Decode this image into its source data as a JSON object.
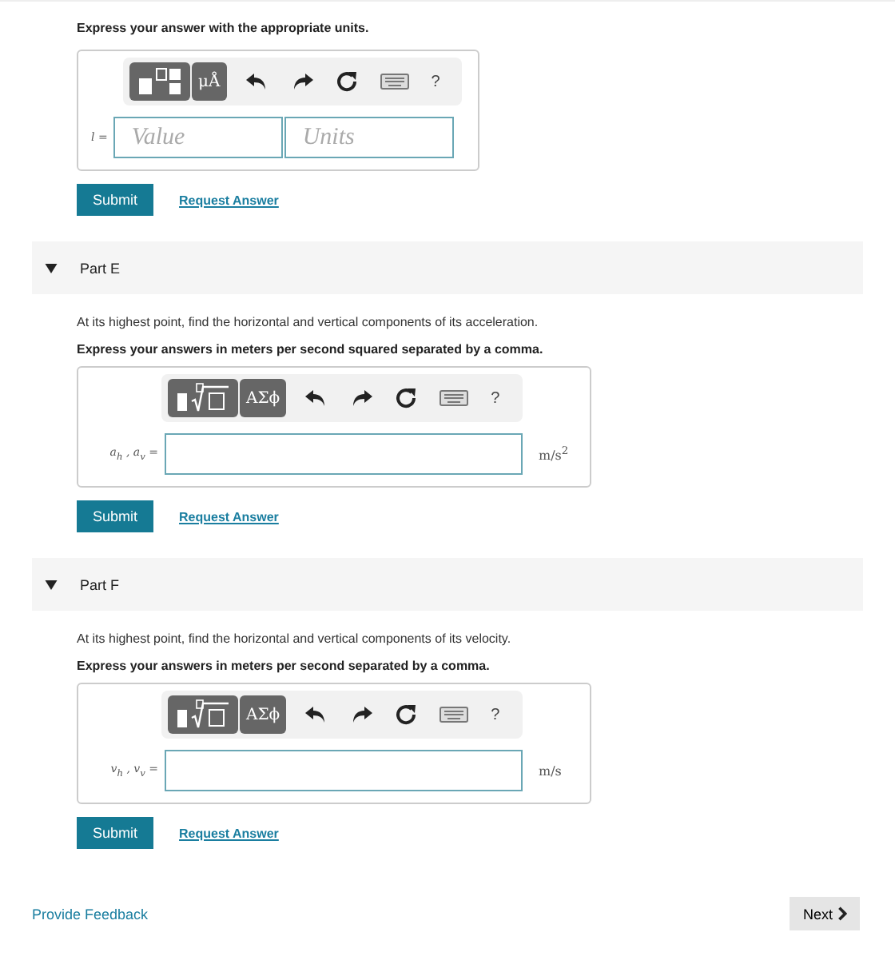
{
  "parts": [
    {
      "instruction": "Express your answer with the appropriate units.",
      "toolbar": [
        {
          "kind": "units-template"
        },
        {
          "kind": "symbols",
          "label": "μÅ"
        },
        {
          "kind": "undo"
        },
        {
          "kind": "redo"
        },
        {
          "kind": "reset"
        },
        {
          "kind": "keyboard"
        },
        {
          "kind": "help",
          "label": "?"
        }
      ],
      "variable": "l =",
      "fields": [
        {
          "kind": "text",
          "placeholder": "Value"
        },
        {
          "kind": "text",
          "placeholder": "Units"
        }
      ],
      "buttons": {
        "submit": "Submit",
        "request": "Request Answer"
      }
    },
    {
      "title": "Part E",
      "expanded": true,
      "question": "At its highest point, find the horizontal and vertical components of its acceleration.",
      "instruction": "Express your answers in meters per second squared separated by a comma.",
      "toolbar": [
        {
          "kind": "math-template"
        },
        {
          "kind": "symbols",
          "label": "ΑΣϕ"
        },
        {
          "kind": "undo"
        },
        {
          "kind": "redo"
        },
        {
          "kind": "reset"
        },
        {
          "kind": "keyboard"
        },
        {
          "kind": "help",
          "label": "?"
        }
      ],
      "variable": "a$_{h}$ , a$_{v}$ =",
      "fields": [
        {
          "kind": "math"
        }
      ],
      "units": "m/s$^{2}$",
      "buttons": {
        "submit": "Submit",
        "request": "Request Answer"
      }
    },
    {
      "title": "Part F",
      "expanded": true,
      "question": "At its highest point, find the horizontal and vertical components of its velocity.",
      "instruction": "Express your answers in meters per second separated by a comma.",
      "toolbar": [
        {
          "kind": "math-template"
        },
        {
          "kind": "symbols",
          "label": "ΑΣϕ"
        },
        {
          "kind": "undo"
        },
        {
          "kind": "redo"
        },
        {
          "kind": "reset"
        },
        {
          "kind": "keyboard"
        },
        {
          "kind": "help",
          "label": "?"
        }
      ],
      "variable": "v$_{h}$ , v$_{v}$ =",
      "fields": [
        {
          "kind": "math"
        }
      ],
      "units": "m/s",
      "buttons": {
        "submit": "Submit",
        "request": "Request Answer"
      }
    }
  ],
  "footer": {
    "feedback": "Provide Feedback",
    "next": "Next"
  }
}
